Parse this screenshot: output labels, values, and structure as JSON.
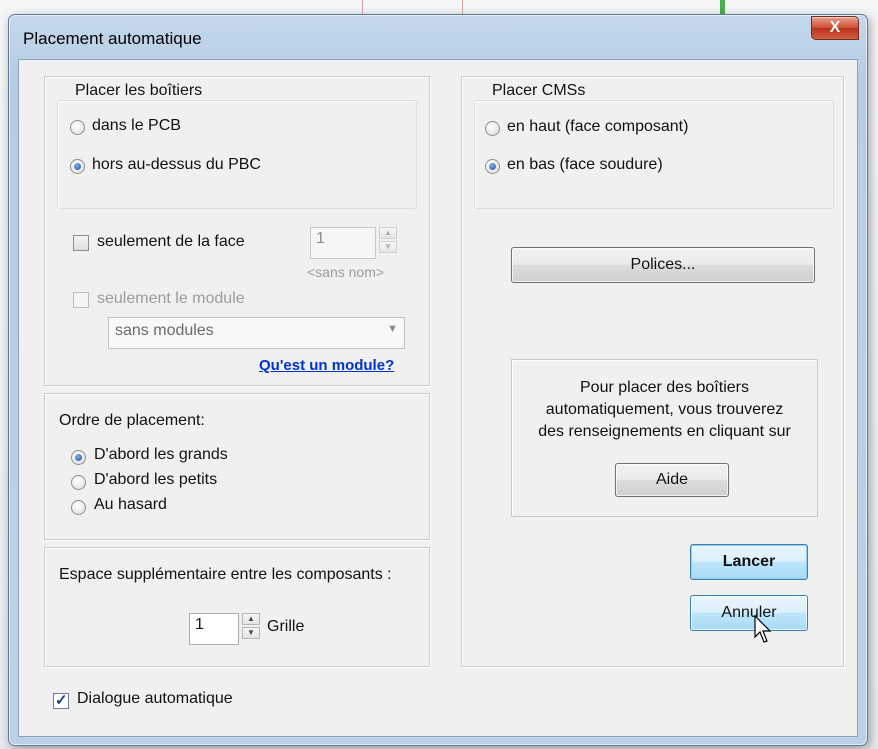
{
  "window": {
    "title": "Placement automatique",
    "close_glyph": "X"
  },
  "placer_boitiers": {
    "heading": "Placer les boîtiers",
    "options": [
      {
        "label": "dans le PCB",
        "selected": false
      },
      {
        "label": "hors au-dessus du PBC",
        "selected": true
      }
    ],
    "face_checkbox_label": "seulement de la face",
    "face_value": "1",
    "face_hint": "<sans nom>",
    "module_checkbox_label": "seulement le module",
    "module_select_value": "sans modules",
    "module_link": "Qu'est un module?"
  },
  "ordre": {
    "heading": "Ordre de placement:",
    "options": [
      {
        "label": "D'abord les grands",
        "selected": true
      },
      {
        "label": "D'abord les petits",
        "selected": false
      },
      {
        "label": "Au hasard",
        "selected": false
      }
    ]
  },
  "espace": {
    "label": "Espace supplémentaire entre les composants :",
    "value": "1",
    "unit": "Grille"
  },
  "placer_cms": {
    "heading": "Placer CMSs",
    "options": [
      {
        "label": "en haut (face composant)",
        "selected": false
      },
      {
        "label": "en bas (face soudure)",
        "selected": true
      }
    ]
  },
  "polices_button": "Polices...",
  "info": {
    "lines": [
      "Pour placer des boîtiers",
      "automatiquement, vous trouverez",
      "des renseignements en cliquant sur"
    ],
    "help_button": "Aide"
  },
  "actions": {
    "launch": "Lancer",
    "cancel": "Annuler"
  },
  "dialogue_auto": {
    "label": "Dialogue automatique",
    "checked": true
  },
  "colors": {
    "accent": "#3c7fb1",
    "link": "#0033cc",
    "close": "#c8462e"
  }
}
